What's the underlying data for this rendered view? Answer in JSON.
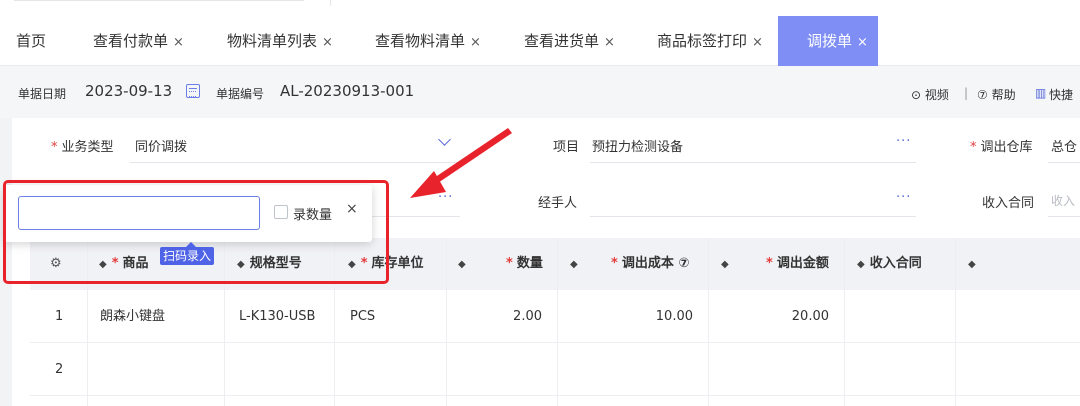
{
  "tabs": [
    {
      "label": "首页",
      "closable": false
    },
    {
      "label": "查看付款单",
      "closable": true
    },
    {
      "label": "物料清单列表",
      "closable": true
    },
    {
      "label": "查看物料清单",
      "closable": true
    },
    {
      "label": "查看进货单",
      "closable": true
    },
    {
      "label": "商品标签打印",
      "closable": true
    },
    {
      "label": "调拨单",
      "closable": true,
      "active": true
    }
  ],
  "close_glyph": "×",
  "infobar": {
    "date_label": "单据日期",
    "date_value": "2023-09-13",
    "no_label": "单据编号",
    "no_value": "AL-20230913-001",
    "video": "⊙ 视频",
    "sep": "|",
    "help": "⑦ 帮助",
    "shortcut": "快捷"
  },
  "form": {
    "biz_type_label": "业务类型",
    "biz_type_value": "同价调拨",
    "project_label": "项目",
    "project_value": "预扭力检测设备",
    "out_wh_label": "调出仓库",
    "out_wh_value": "总仓",
    "handler_label": "经手人",
    "contract_label": "收入合同",
    "contract_placeholder": "收入",
    "ellipsis": "···",
    "req": "*"
  },
  "table": {
    "headers": {
      "product": "商品",
      "spec": "规格型号",
      "unit": "库存单位",
      "qty": "数量",
      "cost": "调出成本 ⑦",
      "amount": "调出金额",
      "contract": "收入合同"
    },
    "sort_glyph": "◆",
    "rows": [
      {
        "no": "1",
        "product": "朗森小键盘",
        "spec": "L-K130-USB",
        "unit": "PCS",
        "qty": "2.00",
        "cost": "10.00",
        "amount": "20.00"
      },
      {
        "no": "2",
        "product": "",
        "spec": "",
        "unit": "",
        "qty": "",
        "cost": "",
        "amount": ""
      }
    ]
  },
  "popup": {
    "input_value": "",
    "checkbox_label": "录数量",
    "close": "×"
  },
  "tooltip": "扫码录入",
  "colors": {
    "accent": "#7e8ef5",
    "annotation": "#e8232b"
  }
}
